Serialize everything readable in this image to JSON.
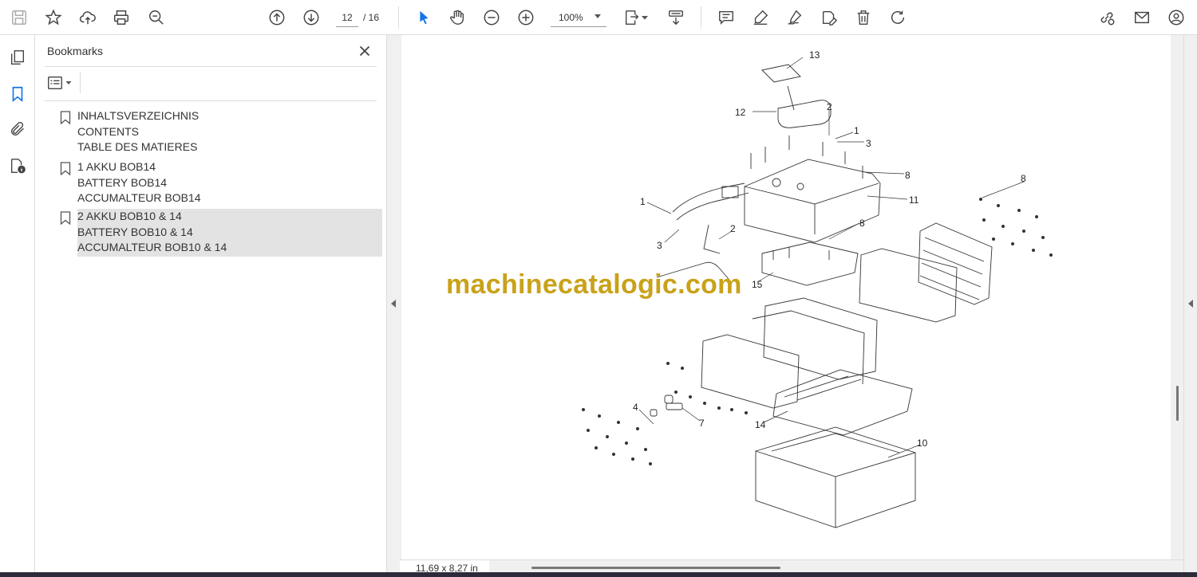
{
  "toolbar": {
    "page_current": "12",
    "page_total": "/ 16",
    "zoom": "100%",
    "icons": [
      "save-icon",
      "star-icon",
      "upload-icon",
      "print-icon",
      "zoom-search-icon",
      "prev-page-icon",
      "next-page-icon",
      "select-cursor-icon",
      "hand-icon",
      "zoom-out-icon",
      "zoom-in-icon",
      "fit-page-icon",
      "scroll-mode-icon",
      "comment-icon",
      "highlight-icon",
      "sign-icon",
      "edit-text-icon",
      "delete-icon",
      "rotate-icon",
      "share-link-icon",
      "email-icon",
      "account-icon"
    ]
  },
  "bookmarks_panel": {
    "title": "Bookmarks",
    "items": [
      {
        "lines": [
          "INHALTSVERZEICHNIS",
          "CONTENTS",
          "TABLE DES MATIERES"
        ],
        "selected": false
      },
      {
        "lines": [
          "1 AKKU BOB14",
          "BATTERY BOB14",
          "ACCUMALTEUR BOB14"
        ],
        "selected": false
      },
      {
        "lines": [
          "2 AKKU BOB10 & 14",
          "BATTERY BOB10 & 14",
          "ACCUMALTEUR BOB10 & 14"
        ],
        "selected": true
      }
    ]
  },
  "document": {
    "watermark": "machinecatalogic.com",
    "callouts": [
      "13",
      "12",
      "2",
      "1",
      "3",
      "8",
      "11",
      "8",
      "1",
      "2",
      "3",
      "8",
      "15",
      "10",
      "4",
      "7",
      "14"
    ],
    "page_size": "11,69 x 8,27 in"
  },
  "colors": {
    "accent": "#1473e6",
    "watermark": "#c9a21a",
    "selected_bookmark": "#e3e3e3"
  }
}
